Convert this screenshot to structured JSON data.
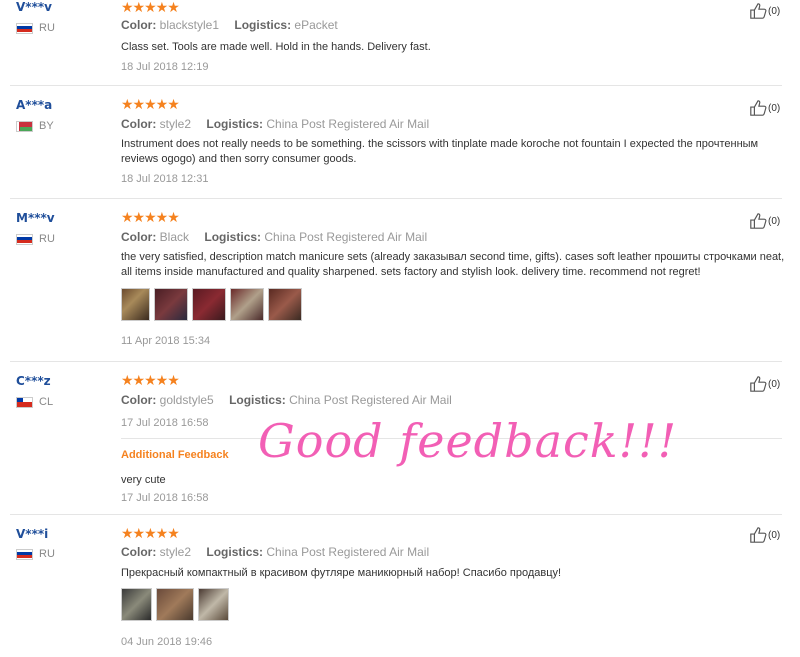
{
  "like_label": "(0)",
  "reviews": [
    {
      "user": "V***v",
      "country": "RU",
      "rating": "★★★★★",
      "color_label": "Color:",
      "color_value": "blackstyle1",
      "logistics_label": "Logistics:",
      "logistics_value": "ePacket",
      "text": "Class set. Tools are made well. Hold in the hands. Delivery fast.",
      "date": "18 Jul 2018 12:19"
    },
    {
      "user": "A***a",
      "country": "BY",
      "rating": "★★★★★",
      "color_label": "Color:",
      "color_value": "style2",
      "logistics_label": "Logistics:",
      "logistics_value": "China Post Registered Air Mail",
      "text": "Instrument does not really needs to be something. the scissors with tinplate made koroche not fountain I expected the прочтенным reviews ogogo) and then sorry consumer goods.",
      "date": "18 Jul 2018 12:31"
    },
    {
      "user": "M***v",
      "country": "RU",
      "rating": "★★★★★",
      "color_label": "Color:",
      "color_value": "Black",
      "logistics_label": "Logistics:",
      "logistics_value": "China Post Registered Air Mail",
      "text": "the very satisfied, description match manicure sets (already заказывал second time, gifts). cases soft leather прошиты строчками neat, all items inside manufactured and quality sharpened. sets factory and stylish look. delivery time. recommend not regret!",
      "date": "11 Apr 2018 15:34"
    },
    {
      "user": "C***z",
      "country": "CL",
      "rating": "★★★★★",
      "color_label": "Color:",
      "color_value": "goldstyle5",
      "logistics_label": "Logistics:",
      "logistics_value": "China Post Registered Air Mail",
      "text": "",
      "date": "17 Jul 2018 16:58",
      "additional_title": "Additional Feedback",
      "additional_text": "very cute",
      "additional_date": "17 Jul 2018 16:58"
    },
    {
      "user": "V***i",
      "country": "RU",
      "rating": "★★★★★",
      "color_label": "Color:",
      "color_value": "style2",
      "logistics_label": "Logistics:",
      "logistics_value": "China Post Registered Air Mail",
      "text": "Прекрасный компактный в красивом футляре маникюрный набор! Спасибо продавцу!",
      "date": "04 Jun 2018 19:46"
    }
  ],
  "overlay_text": "Good feedback!!!",
  "colors": {
    "accent": "#f5821f",
    "username": "#1f4e9a",
    "overlay": "#f25fb5"
  }
}
